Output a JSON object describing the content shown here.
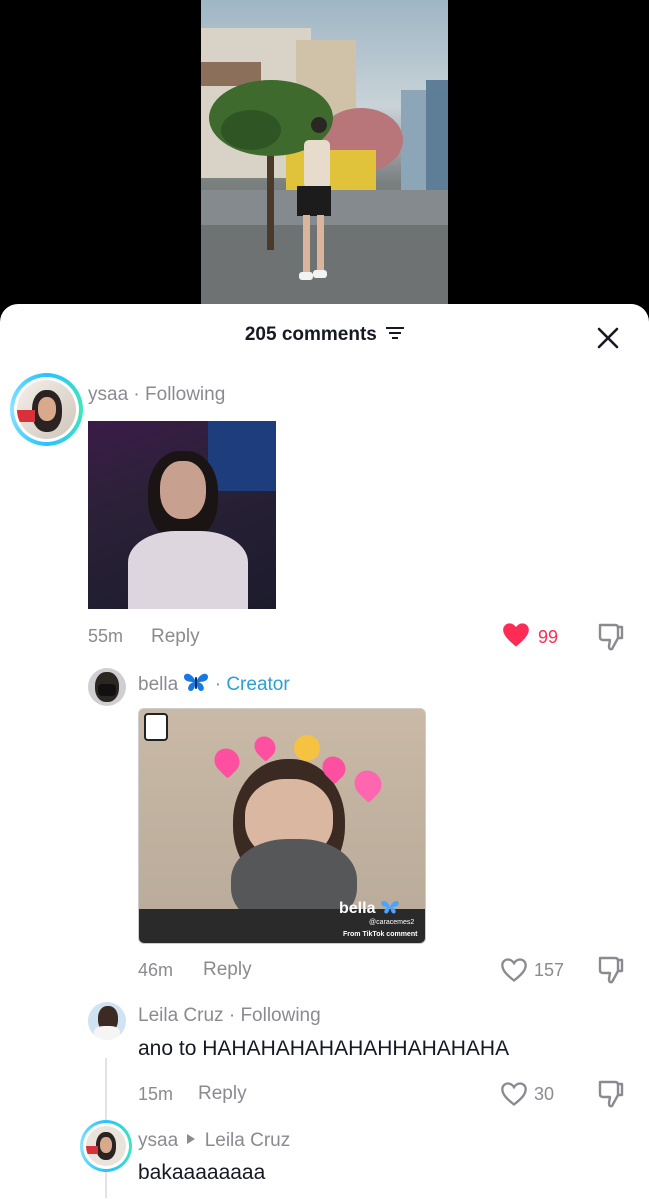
{
  "header": {
    "title": "205 comments"
  },
  "comments": [
    {
      "username": "ysaa",
      "relation": "Following",
      "time": "55m",
      "reply_label": "Reply",
      "likes": "99",
      "liked": true
    },
    {
      "username": "bella",
      "relation": "Creator",
      "sticker_label": "bella",
      "sticker_sub": "@caracemes2",
      "sticker_watermark": "From TikTok comment",
      "time": "46m",
      "reply_label": "Reply",
      "likes": "157",
      "liked": false
    },
    {
      "username": "Leila Cruz",
      "relation": "Following",
      "text": "ano to HAHAHAHAHAHAHHAHAHAHA",
      "time": "15m",
      "reply_label": "Reply",
      "likes": "30",
      "liked": false
    },
    {
      "username": "ysaa",
      "reply_to": "Leila Cruz",
      "text": "bakaaaaaaaa"
    }
  ],
  "colors": {
    "liked": "#fe2c55",
    "creator": "#2a9fd6",
    "muted": "#8a8b91"
  }
}
